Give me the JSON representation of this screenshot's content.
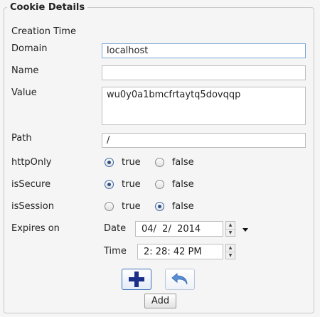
{
  "panel": {
    "title": "Cookie Details"
  },
  "labels": {
    "creation_time": "Creation Time",
    "domain": "Domain",
    "name": "Name",
    "value": "Value",
    "path": "Path",
    "http_only": "httpOnly",
    "is_secure": "isSecure",
    "is_session": "isSession",
    "expires_on": "Expires on",
    "date": "Date",
    "time": "Time"
  },
  "fields": {
    "domain": "localhost",
    "name": "",
    "value": "wu0y0a1bmcfrtaytq5dovqqp",
    "path": "/"
  },
  "radios": {
    "true_label": "true",
    "false_label": "false",
    "http_only": "true",
    "is_secure": "true",
    "is_session": "false"
  },
  "expires": {
    "date": "04/  2/  2014",
    "time": "2: 28: 42 PM"
  },
  "buttons": {
    "add_label": "Add"
  },
  "icons": {
    "add": "plus-icon",
    "undo": "undo-arrow-icon"
  },
  "colors": {
    "accent": "#1a2f8a",
    "undo_icon": "#5a8fd6"
  }
}
